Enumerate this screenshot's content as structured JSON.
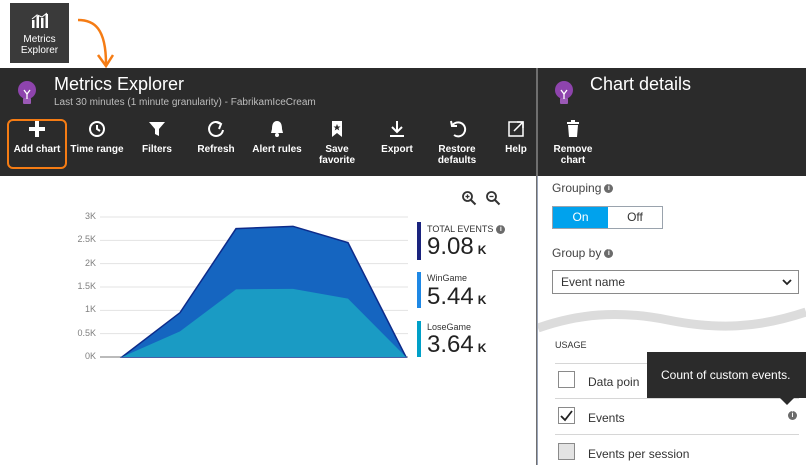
{
  "tile": {
    "label_line1": "Metrics",
    "label_line2": "Explorer"
  },
  "left_blade": {
    "title": "Metrics Explorer",
    "subtitle": "Last 30 minutes (1 minute granularity) - FabrikamIceCream",
    "toolbar": [
      {
        "label_line1": "Add chart",
        "label_line2": "",
        "icon": "plus-icon"
      },
      {
        "label_line1": "Time range",
        "label_line2": "",
        "icon": "clock-icon"
      },
      {
        "label_line1": "Filters",
        "label_line2": "",
        "icon": "filter-icon"
      },
      {
        "label_line1": "Refresh",
        "label_line2": "",
        "icon": "refresh-icon"
      },
      {
        "label_line1": "Alert rules",
        "label_line2": "",
        "icon": "bell-icon"
      },
      {
        "label_line1": "Save",
        "label_line2": "favorite",
        "icon": "bookmark-icon"
      },
      {
        "label_line1": "Export",
        "label_line2": "",
        "icon": "download-icon"
      },
      {
        "label_line1": "Restore",
        "label_line2": "defaults",
        "icon": "undo-icon"
      },
      {
        "label_line1": "Help",
        "label_line2": "",
        "icon": "external-link-icon"
      }
    ]
  },
  "right_blade": {
    "title": "Chart details",
    "toolbar": [
      {
        "label_line1": "Remove",
        "label_line2": "chart",
        "icon": "trash-icon"
      }
    ],
    "grouping_label": "Grouping",
    "grouping_on": "On",
    "grouping_off": "Off",
    "group_by_label": "Group by",
    "group_by_value": "Event name",
    "usage_header": "USAGE",
    "rows": [
      {
        "label": "Data poin",
        "checked": false
      },
      {
        "label": "Events",
        "checked": true
      },
      {
        "label": "Events per session",
        "checked": false
      }
    ],
    "tooltip": "Count of custom events."
  },
  "legend": [
    {
      "name": "TOTAL EVENTS",
      "value": "9.08",
      "unit": "K",
      "color": "#1a237e"
    },
    {
      "name": "WinGame",
      "value": "5.44",
      "unit": "K",
      "color": "#1e88e5"
    },
    {
      "name": "LoseGame",
      "value": "3.64",
      "unit": "K",
      "color": "#00a0c8"
    }
  ],
  "chart_data": {
    "type": "area",
    "y_ticks": [
      "3K",
      "2.5K",
      "2K",
      "1.5K",
      "1K",
      "0.5K",
      "0K"
    ],
    "ylim": [
      0,
      3000
    ],
    "x": [
      0,
      1,
      2,
      3,
      4,
      5,
      6
    ],
    "series": [
      {
        "name": "TOTAL EVENTS",
        "values": [
          0,
          950,
          2750,
          2800,
          2450,
          0,
          0
        ],
        "color": "#1565c0",
        "stroke": "#0d2b8a"
      },
      {
        "name": "LoseGame",
        "values": [
          0,
          550,
          1450,
          1460,
          1250,
          0,
          0
        ],
        "color": "#1a9bc4"
      }
    ]
  },
  "colors": {
    "accent": "#00a2ed",
    "highlight": "#f57c14",
    "header_bg": "#2b2b2b"
  }
}
